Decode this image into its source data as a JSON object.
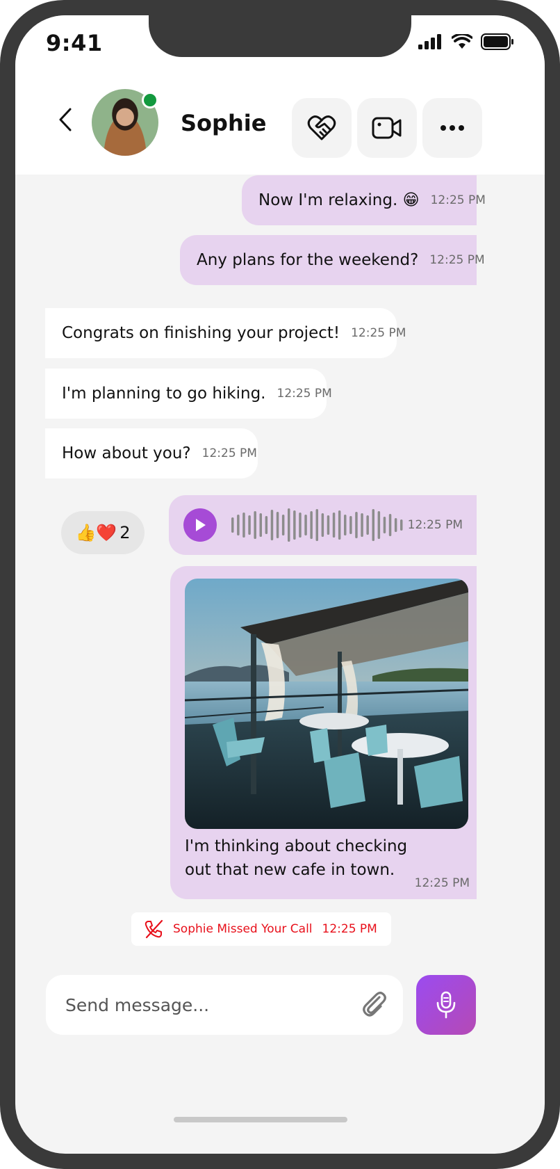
{
  "status_bar": {
    "time": "9:41"
  },
  "header": {
    "contact_name": "Sophie",
    "status": "online"
  },
  "messages": [
    {
      "direction": "out",
      "text": "Now I'm relaxing. 😁",
      "time": "12:25 PM"
    },
    {
      "direction": "out",
      "text": "Any plans for the weekend?",
      "time": "12:25 PM"
    },
    {
      "direction": "in",
      "text": "Congrats on finishing your project!",
      "time": "12:25 PM"
    },
    {
      "direction": "in",
      "text": "I'm planning to go hiking.",
      "time": "12:25 PM"
    },
    {
      "direction": "in",
      "text": "How about you?",
      "time": "12:25 PM"
    }
  ],
  "reaction": {
    "emojis": "👍❤️",
    "count": "2"
  },
  "voice_message": {
    "time": "12:25 PM"
  },
  "photo_message": {
    "caption": "I'm thinking about checking out that new cafe in town.",
    "time": "12:25 PM"
  },
  "missed_call": {
    "text": "Sophie Missed Your Call",
    "time": "12:25 PM"
  },
  "composer": {
    "placeholder": "Send message..."
  },
  "colors": {
    "outgoing_bubble": "#e7d3ef",
    "accent": "#a64bd6",
    "missed": "#e8101b",
    "online": "#12993e"
  },
  "icons": [
    "back-icon",
    "heart-handshake-icon",
    "video-call-icon",
    "more-icon",
    "play-icon",
    "phone-missed-icon",
    "paperclip-icon",
    "microphone-icon"
  ]
}
